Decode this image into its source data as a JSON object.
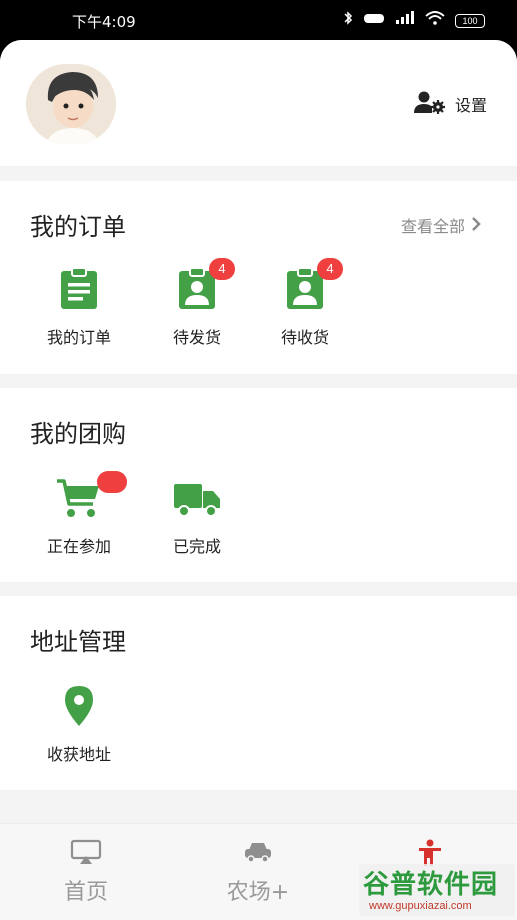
{
  "status_bar": {
    "time": "下午4:09",
    "battery": "100",
    "icons": [
      "bluetooth-icon",
      "hd-icon",
      "signal-icon",
      "wifi-icon",
      "battery-icon"
    ]
  },
  "profile": {
    "settings_label": "设置",
    "settings_icon": "user-gear-icon"
  },
  "orders": {
    "title": "我的订单",
    "more_label": "查看全部",
    "items": [
      {
        "label": "我的订单",
        "icon": "clipboard-icon"
      },
      {
        "label": "待发货",
        "icon": "user-badge-icon",
        "badge": "4"
      },
      {
        "label": "待收货",
        "icon": "user-badge-icon",
        "badge": "4"
      }
    ]
  },
  "group_buy": {
    "title": "我的团购",
    "items": [
      {
        "label": "正在参加",
        "icon": "cart-icon"
      },
      {
        "label": "已完成",
        "icon": "truck-icon"
      }
    ]
  },
  "address": {
    "title": "地址管理",
    "items": [
      {
        "label": "收获地址",
        "icon": "location-pin-icon"
      }
    ]
  },
  "tabbar": {
    "tabs": [
      {
        "label": "首页",
        "icon": "screen-cast-icon"
      },
      {
        "label": "农场+",
        "icon": "car-icon"
      },
      {
        "label": "",
        "icon": "person-icon"
      }
    ]
  },
  "colors": {
    "accent_green": "#43a047",
    "badge_red": "#ef3f3f",
    "active_red": "#d7312e"
  },
  "watermark": {
    "title": "谷普软件园",
    "url": "www.gupuxiazai.com"
  }
}
